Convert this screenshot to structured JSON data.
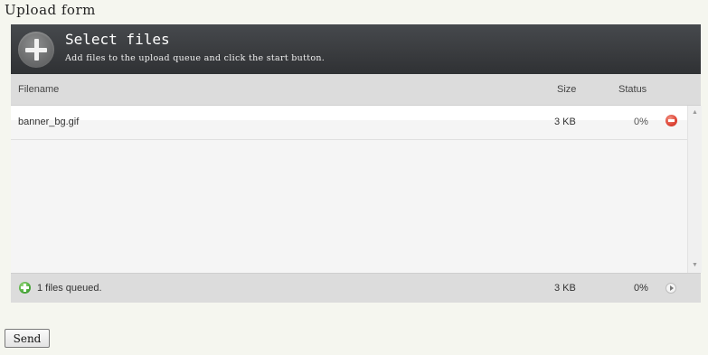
{
  "page": {
    "heading": "Upload form"
  },
  "uploader": {
    "title": "Select files",
    "subtitle": "Add files to the upload queue and click the start button.",
    "columns": {
      "filename": "Filename",
      "size": "Size",
      "status": "Status"
    },
    "files": [
      {
        "name": "banner_bg.gif",
        "size": "3 KB",
        "status": "0%"
      }
    ],
    "footer": {
      "queued": "1 files queued.",
      "total_size": "3 KB",
      "total_percent": "0%"
    },
    "icons": {
      "add": "plus-circle-icon",
      "remove": "remove-icon",
      "queued": "add-icon",
      "start": "play-icon"
    },
    "colors": {
      "header": "#3a3c3f",
      "remove": "#e0483a",
      "queued": "#4aa83a"
    }
  },
  "form": {
    "send_label": "Send"
  }
}
